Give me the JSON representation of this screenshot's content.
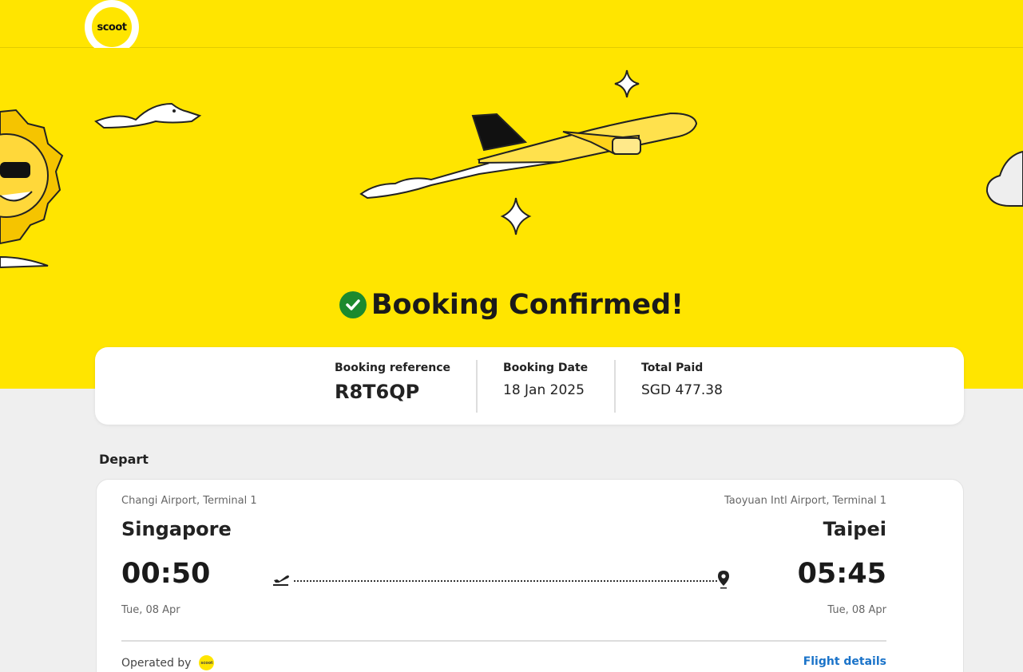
{
  "brand": {
    "logo_text": "scoot"
  },
  "hero": {
    "title": "Booking Confirmed!"
  },
  "summary": {
    "reference_label": "Booking reference",
    "reference_value": "R8T6QP",
    "date_label": "Booking Date",
    "date_value": "18 Jan 2025",
    "total_label": "Total Paid",
    "total_value": "SGD 477.38"
  },
  "depart": {
    "section_label": "Depart",
    "origin": {
      "airport": "Changi Airport, Terminal 1",
      "city": "Singapore",
      "time": "00:50",
      "date": "Tue, 08 Apr"
    },
    "destination": {
      "airport": "Taoyuan Intl Airport, Terminal 1",
      "city": "Taipei",
      "time": "05:45",
      "date": "Tue, 08 Apr"
    },
    "operated_by_label": "Operated by",
    "operator_logo_text": "scoot",
    "details_link": "Flight details"
  },
  "colors": {
    "brand_yellow": "#ffe500",
    "confirm_green": "#1c8a2e",
    "link_blue": "#1a73c9"
  }
}
